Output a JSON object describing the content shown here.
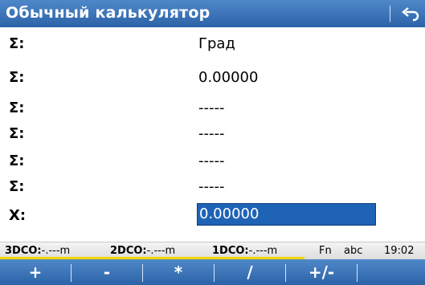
{
  "title": "Обычный калькулятор",
  "icons": {
    "back": "back-arrow-icon"
  },
  "rows": [
    {
      "label": "Σ:",
      "value": "Град"
    },
    {
      "label": "Σ:",
      "value": "0.00000"
    },
    {
      "label": "Σ:",
      "value": "-----"
    },
    {
      "label": "Σ:",
      "value": "-----"
    },
    {
      "label": "Σ:",
      "value": "-----"
    },
    {
      "label": "Σ:",
      "value": "-----"
    }
  ],
  "input_row": {
    "label": "X:",
    "value": "0.00000"
  },
  "status": {
    "dco3_label": "3DCO:",
    "dco3_value": "-.---m",
    "dco2_label": "2DCO:",
    "dco2_value": "-.---m",
    "dco1_label": "1DCO:",
    "dco1_value": "-.---m",
    "fn": "Fn",
    "mode": "abc",
    "time": "19:02"
  },
  "softkeys": [
    "+",
    "-",
    "*",
    "/",
    "+/-",
    ""
  ],
  "colors": {
    "bar_blue": "#2c63a8",
    "input_blue": "#1f63b6",
    "yellow_indicator": "#f2d600"
  }
}
